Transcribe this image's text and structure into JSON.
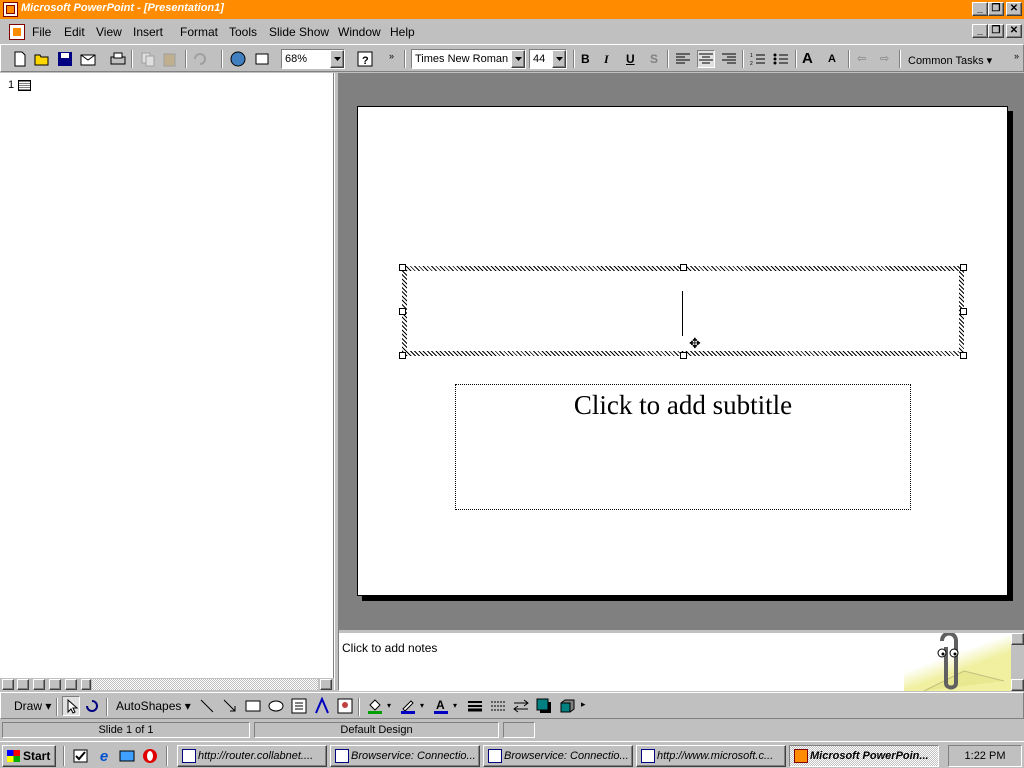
{
  "window": {
    "title": "Microsoft PowerPoint - [Presentation1]",
    "minimize": "_",
    "restore": "❐",
    "close": "✕"
  },
  "menu": [
    "File",
    "Edit",
    "View",
    "Insert",
    "Format",
    "Tools",
    "Slide Show",
    "Window",
    "Help"
  ],
  "toolbar": {
    "zoom": "68%",
    "font": "Times New Roman",
    "font_size": "44",
    "bold": "B",
    "italic": "I",
    "underline": "U",
    "shadow": "S",
    "common_tasks": "Common Tasks"
  },
  "outline": {
    "slide_number": "1"
  },
  "slide": {
    "subtitle_placeholder": "Click to add subtitle"
  },
  "notes": {
    "placeholder": "Click to add notes"
  },
  "drawing": {
    "draw_label": "Draw",
    "autoshapes_label": "AutoShapes"
  },
  "status": {
    "slide": "Slide 1 of 1",
    "design": "Default Design"
  },
  "taskbar": {
    "start": "Start",
    "tasks": [
      "http://router.collabnet....",
      "Browservice: Connectio...",
      "Browservice: Connectio...",
      "http://www.microsoft.c...",
      "Microsoft PowerPoin..."
    ],
    "clock": "1:22 PM"
  },
  "colors": {
    "titlebar": "#ff8c00",
    "desktop_gray": "#c0c0c0",
    "workspace": "#808080"
  }
}
